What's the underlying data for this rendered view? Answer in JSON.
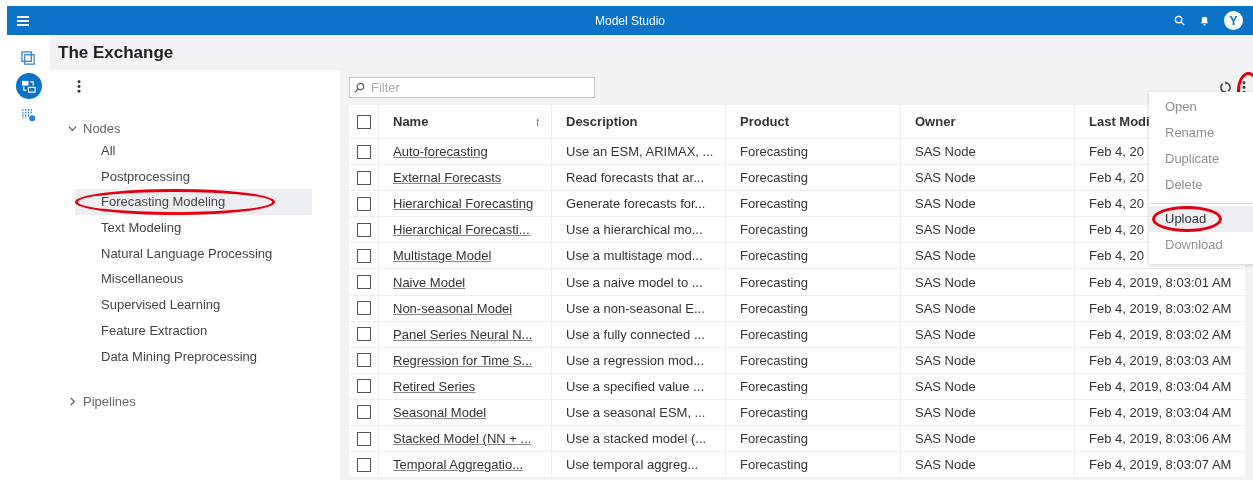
{
  "app_bar": {
    "title": "Model Studio",
    "avatar": "Y"
  },
  "rail": [
    {
      "selected": false
    },
    {
      "selected": true
    },
    {
      "selected": false
    }
  ],
  "page_title": "The Exchange",
  "tree": [
    {
      "label": "Nodes",
      "expanded": true,
      "children": [
        {
          "label": "All",
          "selected": false,
          "circled": false
        },
        {
          "label": "Postprocessing",
          "selected": false,
          "circled": false
        },
        {
          "label": "Forecasting Modeling",
          "selected": true,
          "circled": true
        },
        {
          "label": "Text Modeling",
          "selected": false,
          "circled": false
        },
        {
          "label": "Natural Language Processing",
          "selected": false,
          "circled": false
        },
        {
          "label": "Miscellaneous",
          "selected": false,
          "circled": false
        },
        {
          "label": "Supervised Learning",
          "selected": false,
          "circled": false
        },
        {
          "label": "Feature Extraction",
          "selected": false,
          "circled": false
        },
        {
          "label": "Data Mining Preprocessing",
          "selected": false,
          "circled": false
        }
      ]
    },
    {
      "label": "Pipelines",
      "expanded": false
    }
  ],
  "filter": {
    "placeholder": "Filter"
  },
  "more_button": {
    "circled": true
  },
  "table": {
    "select_all": {
      "checked": false
    },
    "columns": [
      {
        "label": "Name",
        "sort": "↑"
      },
      {
        "label": "Description"
      },
      {
        "label": "Product"
      },
      {
        "label": "Owner"
      },
      {
        "label": "Last Modi"
      }
    ],
    "rows": [
      {
        "checked": false,
        "name": "Auto-forecasting",
        "description": "Use an ESM, ARIMAX, ...",
        "product": "Forecasting",
        "owner": "SAS Node",
        "modified": "Feb 4, 20"
      },
      {
        "checked": false,
        "name": "External Forecasts",
        "description": "Read forecasts that ar...",
        "product": "Forecasting",
        "owner": "SAS Node",
        "modified": "Feb 4, 20"
      },
      {
        "checked": false,
        "name": "Hierarchical Forecasting",
        "description": "Generate forecasts for...",
        "product": "Forecasting",
        "owner": "SAS Node",
        "modified": "Feb 4, 20"
      },
      {
        "checked": false,
        "name": "Hierarchical Forecasti...",
        "description": "Use a hierarchical mo...",
        "product": "Forecasting",
        "owner": "SAS Node",
        "modified": "Feb 4, 20"
      },
      {
        "checked": false,
        "name": "Multistage Model",
        "description": "Use a multistage mod...",
        "product": "Forecasting",
        "owner": "SAS Node",
        "modified": "Feb 4, 20"
      },
      {
        "checked": false,
        "name": "Naive Model",
        "description": "Use a naive model to ...",
        "product": "Forecasting",
        "owner": "SAS Node",
        "modified": "Feb 4, 2019, 8:03:01 AM"
      },
      {
        "checked": false,
        "name": "Non-seasonal Model",
        "description": "Use a non-seasonal E...",
        "product": "Forecasting",
        "owner": "SAS Node",
        "modified": "Feb 4, 2019, 8:03:02 AM"
      },
      {
        "checked": false,
        "name": "Panel Series Neural N...",
        "description": "Use a fully connected ...",
        "product": "Forecasting",
        "owner": "SAS Node",
        "modified": "Feb 4, 2019, 8:03:02 AM"
      },
      {
        "checked": false,
        "name": "Regression for Time S...",
        "description": "Use a regression mod...",
        "product": "Forecasting",
        "owner": "SAS Node",
        "modified": "Feb 4, 2019, 8:03:03 AM"
      },
      {
        "checked": false,
        "name": "Retired Series",
        "description": "Use a specified value ...",
        "product": "Forecasting",
        "owner": "SAS Node",
        "modified": "Feb 4, 2019, 8:03:04 AM"
      },
      {
        "checked": false,
        "name": "Seasonal Model",
        "description": "Use a seasonal ESM, ...",
        "product": "Forecasting",
        "owner": "SAS Node",
        "modified": "Feb 4, 2019, 8:03:04 AM"
      },
      {
        "checked": false,
        "name": "Stacked Model (NN + ...",
        "description": "Use a stacked model (...",
        "product": "Forecasting",
        "owner": "SAS Node",
        "modified": "Feb 4, 2019, 8:03:06 AM"
      },
      {
        "checked": false,
        "name": "Temporal Aggregatio...",
        "description": "Use temporal aggreg...",
        "product": "Forecasting",
        "owner": "SAS Node",
        "modified": "Feb 4, 2019, 8:03:07 AM"
      }
    ]
  },
  "menu": [
    {
      "label": "Open",
      "disabled": true,
      "hovered": false,
      "circled": false,
      "divider_before": false
    },
    {
      "label": "Rename",
      "disabled": true,
      "hovered": false,
      "circled": false,
      "divider_before": false
    },
    {
      "label": "Duplicate",
      "disabled": true,
      "hovered": false,
      "circled": false,
      "divider_before": false
    },
    {
      "label": "Delete",
      "disabled": true,
      "hovered": false,
      "circled": false,
      "divider_before": false
    },
    {
      "label": "Upload",
      "disabled": false,
      "hovered": true,
      "circled": true,
      "divider_before": true
    },
    {
      "label": "Download",
      "disabled": true,
      "hovered": false,
      "circled": false,
      "divider_before": false
    }
  ]
}
